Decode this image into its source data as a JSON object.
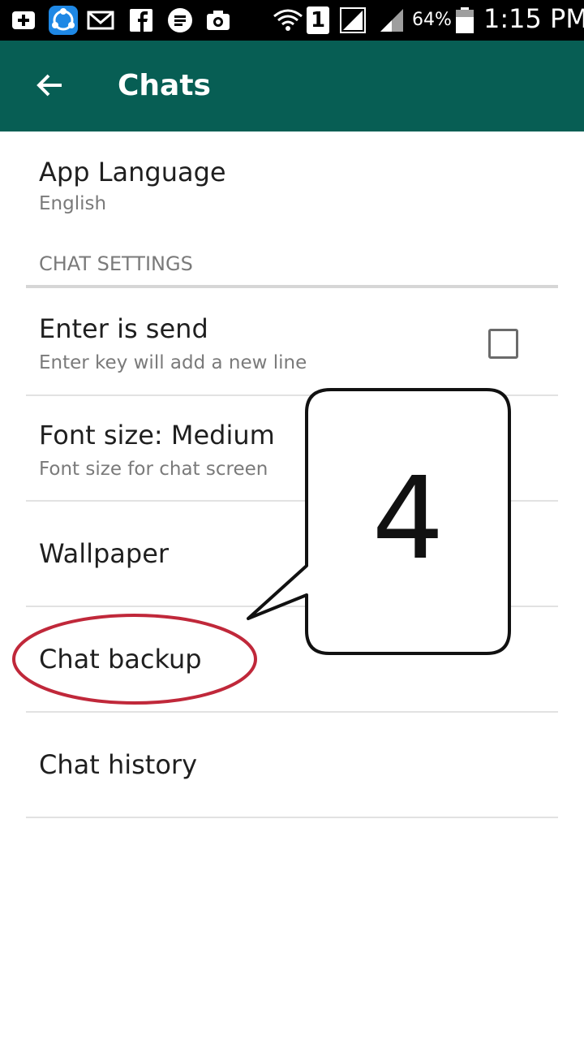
{
  "status_bar": {
    "battery": "64%",
    "time": "1:15 PM",
    "sim_slot": "1",
    "icons": [
      "add-icon",
      "share-app-icon",
      "mail-icon",
      "facebook-icon",
      "message-icon",
      "camera-icon",
      "wifi-icon",
      "sim-icon",
      "signal-icon",
      "signal-icon",
      "battery-icon"
    ]
  },
  "app_bar": {
    "title": "Chats",
    "back_icon": "arrow-back-icon",
    "color": "#075e54"
  },
  "settings": {
    "app_language": {
      "title": "App Language",
      "subtitle": "English"
    },
    "section_header": "CHAT SETTINGS",
    "enter_is_send": {
      "title": "Enter is send",
      "subtitle": "Enter key will add a new line",
      "checked": false
    },
    "font_size": {
      "title": "Font size: Medium",
      "subtitle": "Font size for chat screen"
    },
    "wallpaper": {
      "title": "Wallpaper"
    },
    "chat_backup": {
      "title": "Chat backup"
    },
    "chat_history": {
      "title": "Chat history"
    }
  },
  "annotation": {
    "callout_number": "4",
    "highlight_color": "#c0283a"
  }
}
